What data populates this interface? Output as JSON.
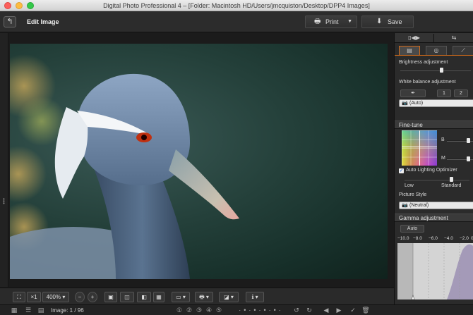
{
  "window": {
    "title": "Digital Photo Professional 4 – [Folder: Macintosh HD/Users/jmcquiston/Desktop/DPP4 Images]"
  },
  "toolbar": {
    "back_icon": "back-arrow-icon",
    "page_title": "Edit Image",
    "print_label": "Print",
    "save_label": "Save"
  },
  "image_toolbar": {
    "fit_icon": "fit-screen-icon",
    "zoom_1x": "×1",
    "zoom_level": "400%",
    "zoom_out": "−",
    "zoom_in": "+"
  },
  "status_bar": {
    "image_count": "Image: 1 / 96"
  },
  "right_panel": {
    "tabs_row1": [
      "▯◀▶",
      "⇆"
    ],
    "tabs_row2": [
      "▤",
      "◎",
      "⟋"
    ],
    "brightness_label": "Brightness adjustment",
    "brightness_value": 0.58,
    "wb_label": "White balance adjustment",
    "wb_buttons": [
      "✒",
      "1",
      "2"
    ],
    "wb_select": "(Auto)",
    "finetune_header": "Fine-tune",
    "finetune_b": "B",
    "finetune_m": "M",
    "alo_label": "Auto Lighting Optimizer",
    "alo_checked": true,
    "alo_low": "Low",
    "alo_standard": "Standard",
    "picture_style_label": "Picture Style",
    "picture_style_value": "(Neutral)",
    "gamma_header": "Gamma adjustment",
    "gamma_auto": "Auto",
    "gamma_ticks": [
      "−10.0",
      "−8.0",
      "−6.0",
      "−4.0",
      "−2.0",
      "0"
    ]
  }
}
